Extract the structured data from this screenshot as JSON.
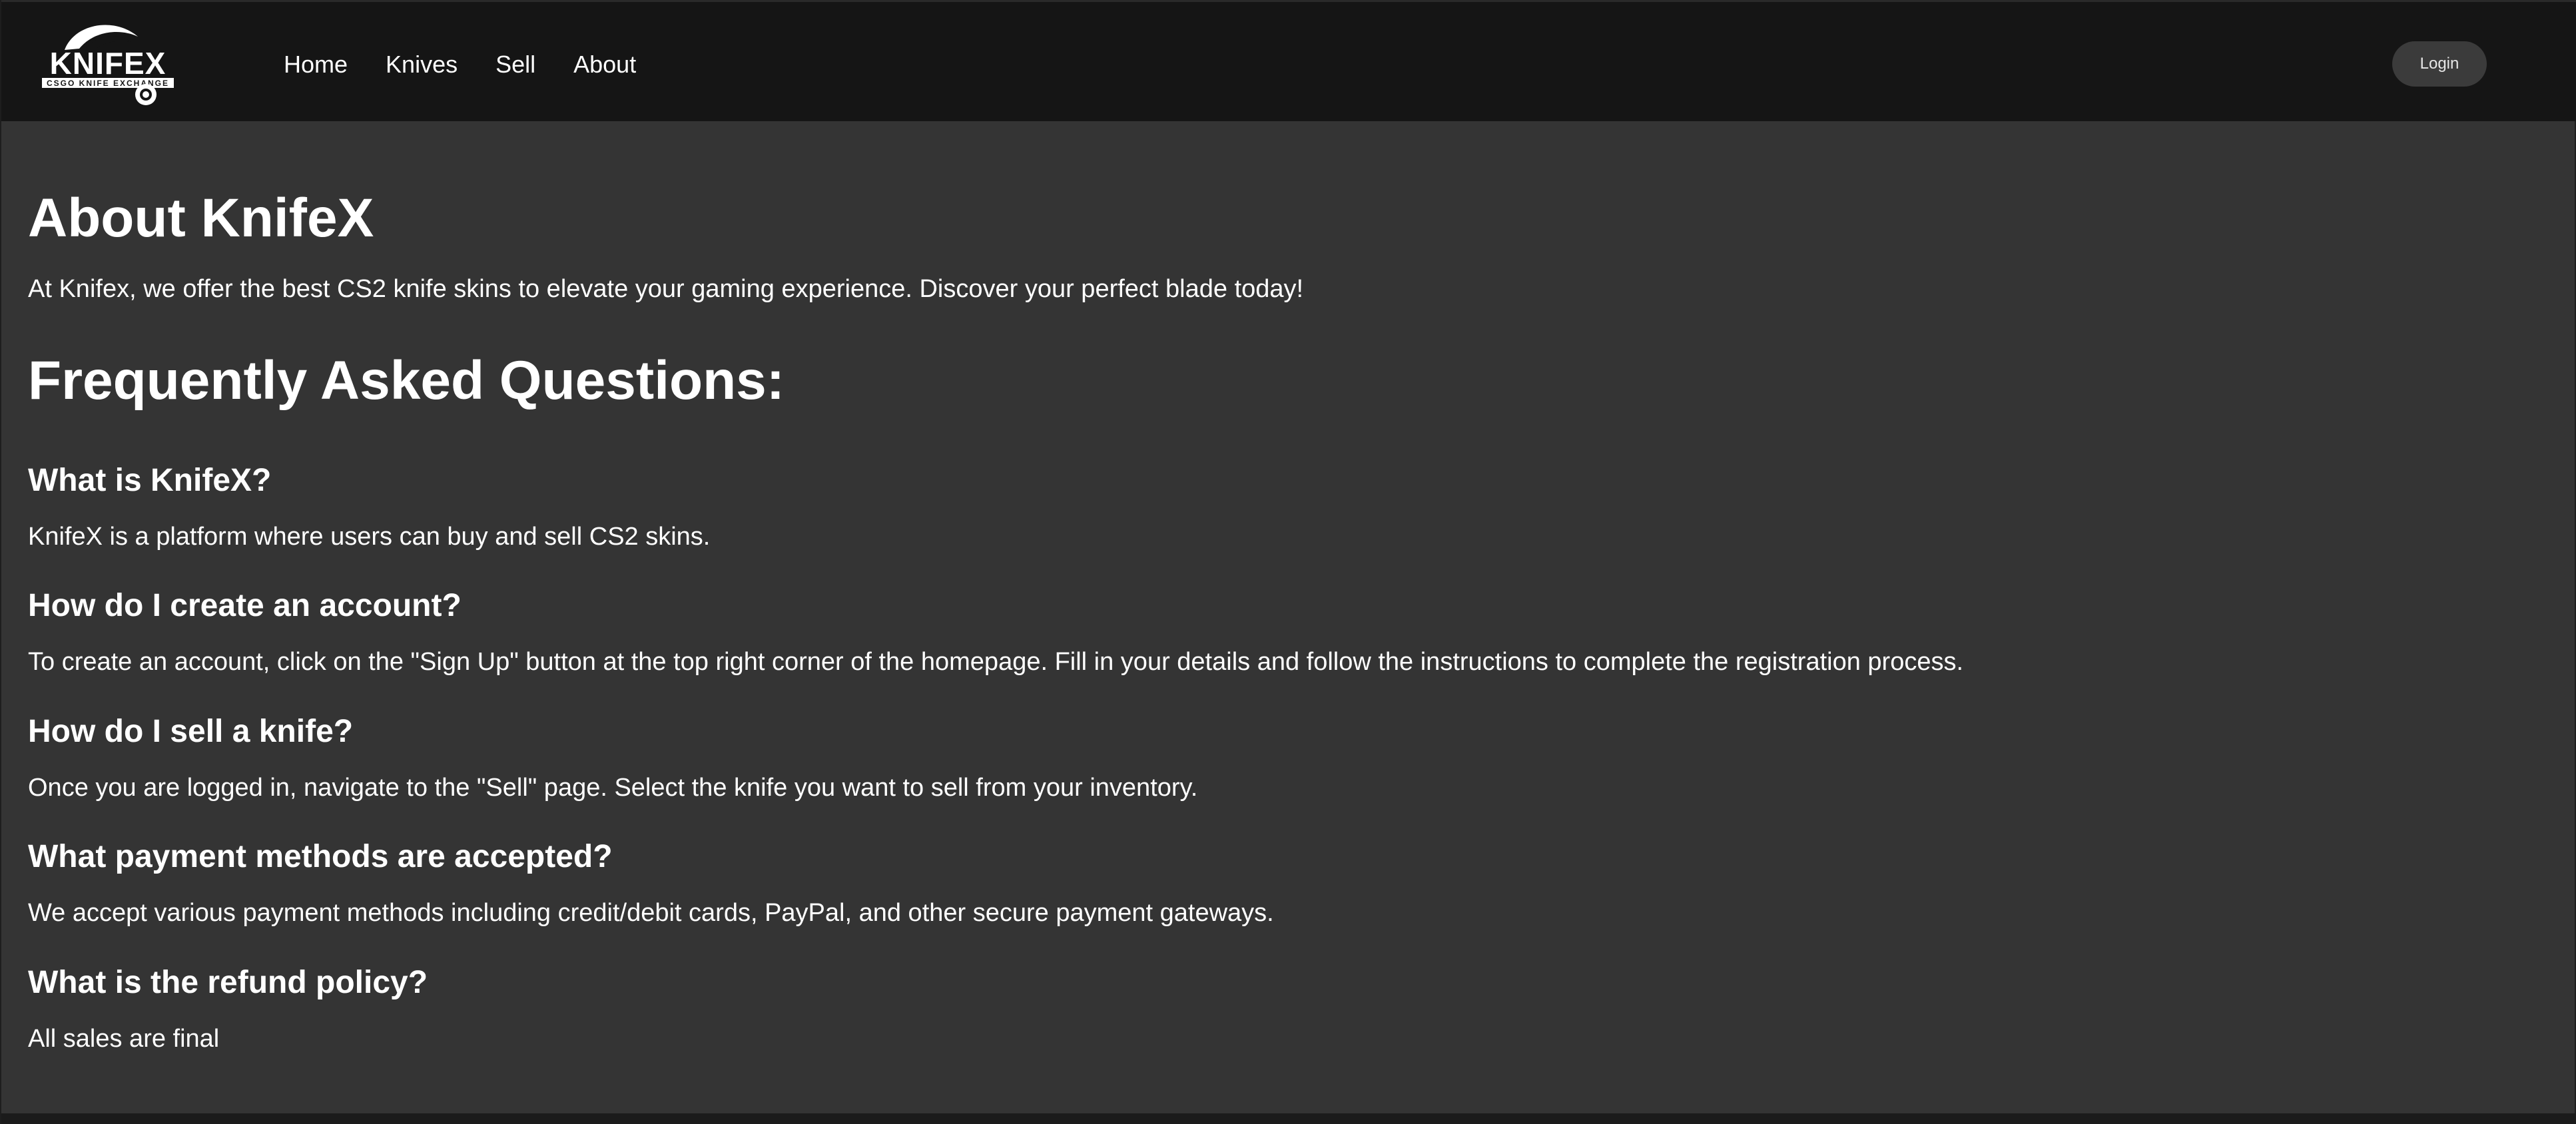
{
  "header": {
    "logo": {
      "main_text": "KNIFEX",
      "sub_text": "CSGO KNIFE EXCHANGE"
    },
    "nav": [
      {
        "label": "Home"
      },
      {
        "label": "Knives"
      },
      {
        "label": "Sell"
      },
      {
        "label": "About"
      }
    ],
    "login_label": "Login"
  },
  "main": {
    "title": "About KnifeX",
    "intro": "At Knifex, we offer the best CS2 knife skins to elevate your gaming experience. Discover your perfect blade today!",
    "faq_title": "Frequently Asked Questions:",
    "faqs": [
      {
        "question": "What is KnifeX?",
        "answer": "KnifeX is a platform where users can buy and sell CS2 skins."
      },
      {
        "question": "How do I create an account?",
        "answer": "To create an account, click on the \"Sign Up\" button at the top right corner of the homepage. Fill in your details and follow the instructions to complete the registration process."
      },
      {
        "question": "How do I sell a knife?",
        "answer": "Once you are logged in, navigate to the \"Sell\" page. Select the knife you want to sell from your inventory."
      },
      {
        "question": "What payment methods are accepted?",
        "answer": "We accept various payment methods including credit/debit cards, PayPal, and other secure payment gateways."
      },
      {
        "question": "What is the refund policy?",
        "answer": "All sales are final"
      }
    ]
  },
  "colors": {
    "header_bg": "#151515",
    "page_bg": "#343434",
    "text": "#ffffff",
    "login_bg": "#3b3b3b"
  }
}
